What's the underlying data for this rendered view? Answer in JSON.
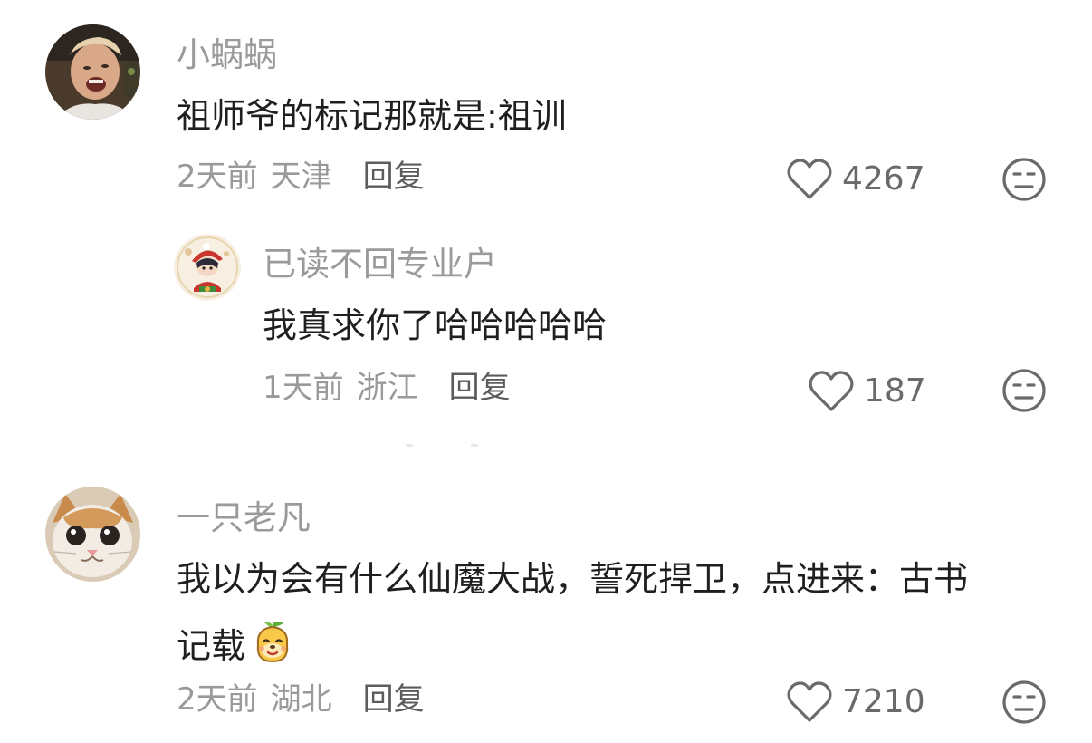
{
  "comments": [
    {
      "username": "小蜗蜗",
      "text": "祖师爷的标记那就是:祖训",
      "time": "2天前",
      "location": "天津",
      "reply_label": "回复",
      "likes": "4267",
      "avatar_icon": "person-avatar",
      "reply": {
        "username": "已读不回专业户",
        "text": "我真求你了哈哈哈哈哈",
        "time": "1天前",
        "location": "浙江",
        "reply_label": "回复",
        "likes": "187",
        "avatar_icon": "cartoon-avatar"
      }
    },
    {
      "username": "一只老凡",
      "text_line1": "我以为会有什么仙魔大战，誓死捍卫，点进来：古书",
      "text_line2": "记载",
      "emoji": "smirk-pear-emoji",
      "time": "2天前",
      "location": "湖北",
      "reply_label": "回复",
      "likes": "7210",
      "avatar_icon": "cat-avatar"
    }
  ],
  "icons": {
    "like": "heart-outline-icon",
    "dislike": "unamused-face-icon"
  }
}
